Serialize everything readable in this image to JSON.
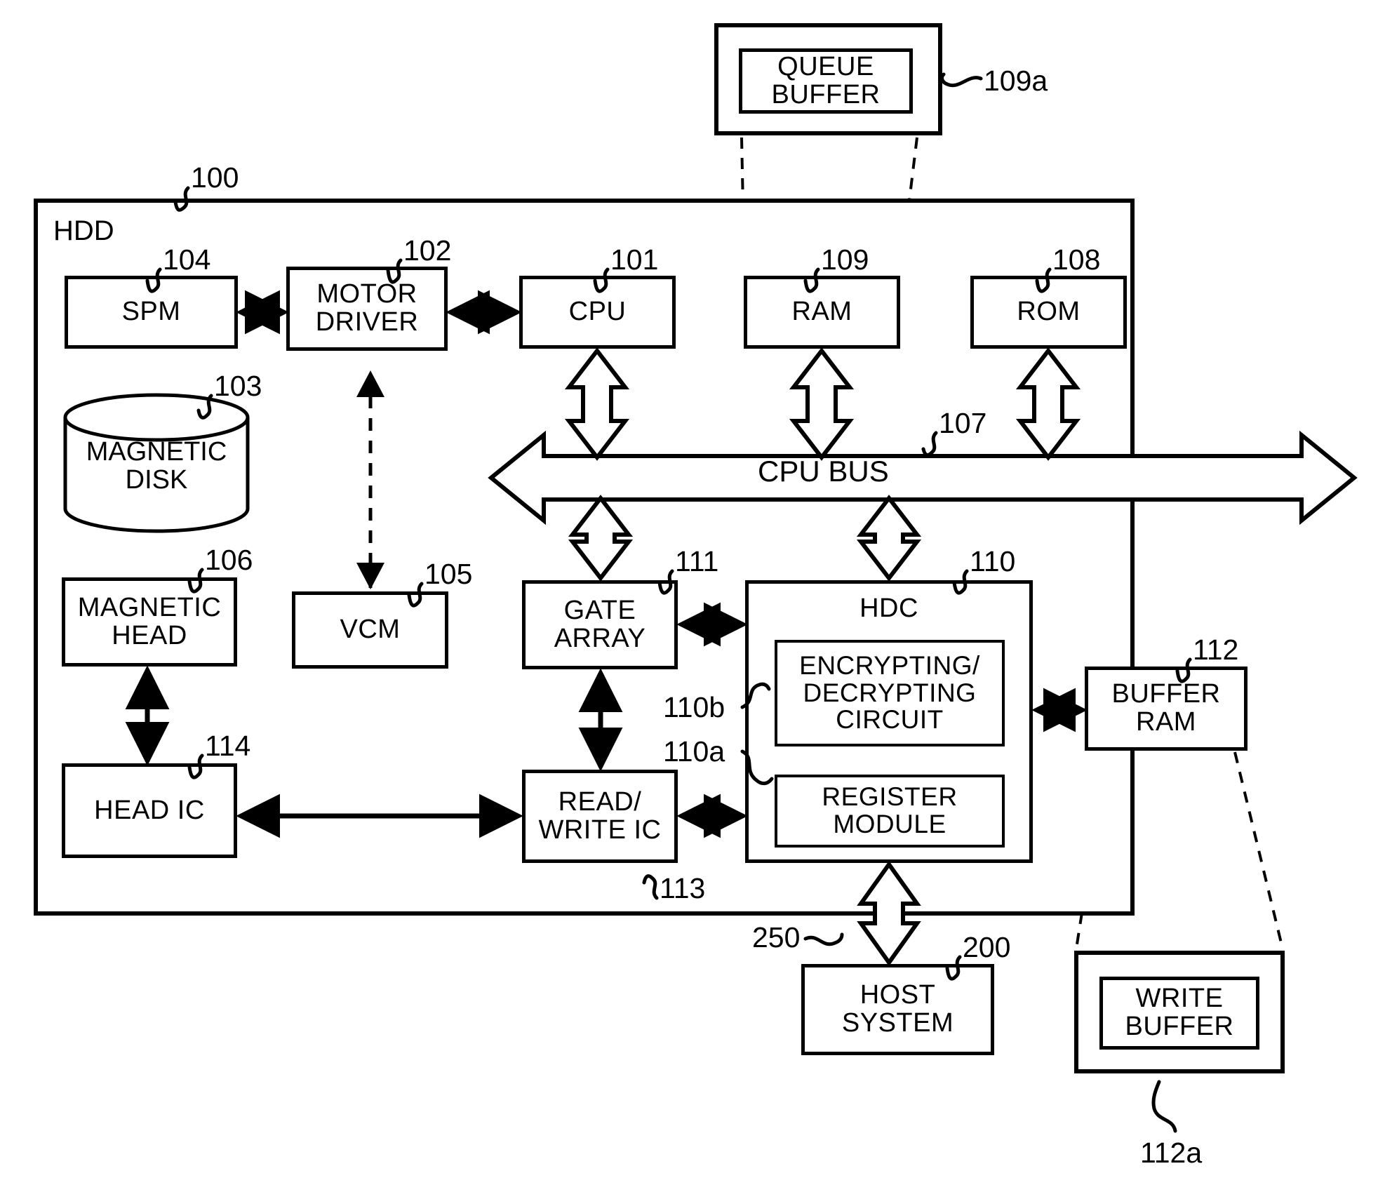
{
  "figure": {
    "type": "patent-block-diagram",
    "subject": "Hard disk drive (HDD) system block diagram"
  },
  "blocks": {
    "queue_buffer": "QUEUE\nBUFFER",
    "hdd_label": "HDD",
    "spm": "SPM",
    "motor_driver": "MOTOR\nDRIVER",
    "cpu": "CPU",
    "ram": "RAM",
    "rom": "ROM",
    "cpu_bus": "CPU BUS",
    "magnetic_disk": "MAGNETIC\nDISK",
    "magnetic_head": "MAGNETIC\nHEAD",
    "vcm": "VCM",
    "gate_array": "GATE\nARRAY",
    "hdc": "HDC",
    "encrypting_decrypting_circuit": "ENCRYPTING/\nDECRYPTING\nCIRCUIT",
    "register_module": "REGISTER\nMODULE",
    "buffer_ram": "BUFFER\nRAM",
    "head_ic": "HEAD IC",
    "read_write_ic": "READ/\nWRITE IC",
    "host_system": "HOST\nSYSTEM",
    "write_buffer": "WRITE\nBUFFER"
  },
  "reference_numerals": {
    "n100": "100",
    "n101": "101",
    "n102": "102",
    "n103": "103",
    "n104": "104",
    "n105": "105",
    "n106": "106",
    "n107": "107",
    "n108": "108",
    "n109": "109",
    "n109a": "109a",
    "n110": "110",
    "n110a": "110a",
    "n110b": "110b",
    "n111": "111",
    "n112": "112",
    "n112a": "112a",
    "n113": "113",
    "n114": "114",
    "n200": "200",
    "n250": "250"
  },
  "colors": {
    "ink": "#000000",
    "paper": "#ffffff"
  }
}
